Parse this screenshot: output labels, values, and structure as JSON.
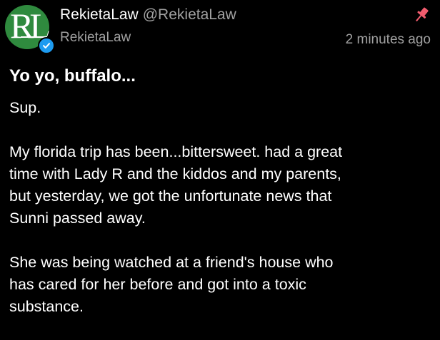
{
  "header": {
    "display_name": "RekietaLaw",
    "handle": "@RekietaLaw",
    "sub_name": "RekietaLaw",
    "timestamp": "2 minutes ago",
    "avatar_text": "RL"
  },
  "post": {
    "title": "Yo yo, buffalo...",
    "paragraphs": [
      "Sup.",
      "My florida trip has been...bittersweet.  had a great\ntime with Lady R and the kiddos and my parents,\nbut yesterday, we got the unfortunate news that\nSunni passed away.",
      "She was being watched at a friend's house who\nhas cared for her before and got into a toxic\nsubstance."
    ]
  },
  "colors": {
    "background": "#000000",
    "text": "#ffffff",
    "muted": "#a0a0a0",
    "avatar_bg": "#2f8a3e",
    "verified": "#1d9bf0",
    "pin": "#f25c6e"
  },
  "icons": {
    "verified": "verified-badge-icon",
    "pin": "pin-icon"
  }
}
